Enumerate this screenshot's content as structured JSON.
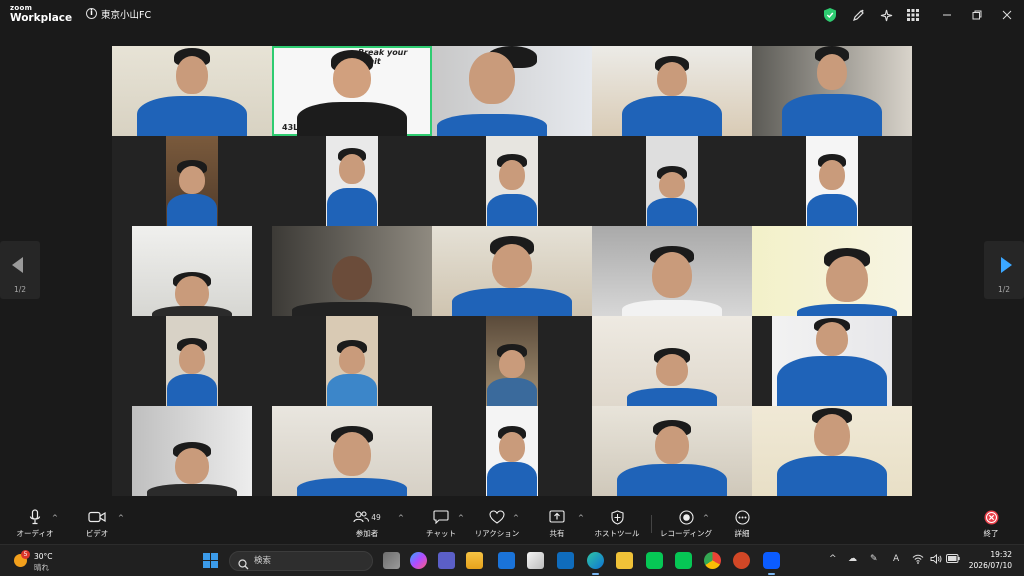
{
  "app": {
    "logo_line1": "zoom",
    "logo_line2": "Workplace",
    "info_glyph": "i",
    "meeting_title": "東京小山FC"
  },
  "title_bar_icons": [
    "shield-icon",
    "pen-icon",
    "sparkle-icon",
    "grid-icon"
  ],
  "window_controls": [
    "minimize",
    "restore",
    "close"
  ],
  "gallery": {
    "page_indicator_left": "1/2",
    "page_indicator_right": "1/2",
    "active_speaker_caption_top": "Break your Limit",
    "active_speaker_caption_bottom": "43Lab"
  },
  "toolbar": {
    "audio_label": "オーディオ",
    "video_label": "ビデオ",
    "participants_label": "参加者",
    "participants_count": "49",
    "chat_label": "チャット",
    "reactions_label": "リアクション",
    "share_label": "共有",
    "host_tools_label": "ホストツール",
    "recording_label": "レコーディング",
    "more_label": "詳細",
    "end_label": "終了"
  },
  "taskbar": {
    "weather_badge": "5",
    "weather_temp": "30°C",
    "weather_condition": "晴れ",
    "search_placeholder": "検索",
    "time": "19:32",
    "date": "2026/07/10",
    "tray_ime": "A"
  },
  "colors": {
    "accent_green": "#2ecc71",
    "end_red": "#e8404a",
    "jersey_blue": "#1f63b8",
    "arrow_blue": "#3ba7ff"
  }
}
